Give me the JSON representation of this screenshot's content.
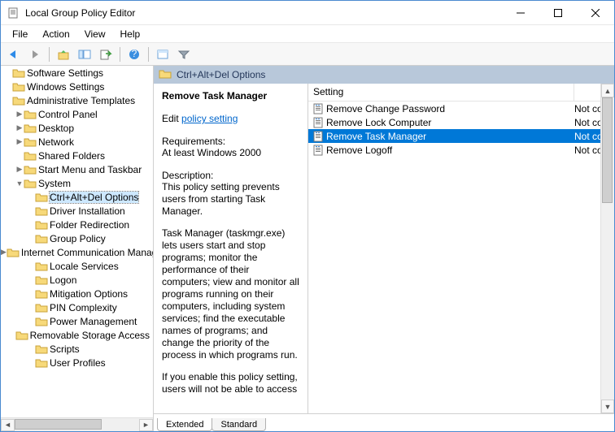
{
  "window": {
    "title": "Local Group Policy Editor"
  },
  "menu": {
    "file": "File",
    "action": "Action",
    "view": "View",
    "help": "Help"
  },
  "toolbar": {
    "back": "back",
    "forward": "forward",
    "up": "up",
    "show_hide_tree": "show-hide-tree",
    "export": "export",
    "refresh": "refresh",
    "help": "help",
    "properties": "properties",
    "filter": "filter"
  },
  "tree": {
    "roots": [
      {
        "label": "Software Settings",
        "depth": 0,
        "caret": ""
      },
      {
        "label": "Windows Settings",
        "depth": 0,
        "caret": ""
      },
      {
        "label": "Administrative Templates",
        "depth": 0,
        "caret": ""
      },
      {
        "label": "Control Panel",
        "depth": 1,
        "caret": ">"
      },
      {
        "label": "Desktop",
        "depth": 1,
        "caret": ">"
      },
      {
        "label": "Network",
        "depth": 1,
        "caret": ">"
      },
      {
        "label": "Shared Folders",
        "depth": 1,
        "caret": ""
      },
      {
        "label": "Start Menu and Taskbar",
        "depth": 1,
        "caret": ">"
      },
      {
        "label": "System",
        "depth": 1,
        "caret": "v"
      },
      {
        "label": "Ctrl+Alt+Del Options",
        "depth": 2,
        "caret": "",
        "selected": true
      },
      {
        "label": "Driver Installation",
        "depth": 2,
        "caret": ""
      },
      {
        "label": "Folder Redirection",
        "depth": 2,
        "caret": ""
      },
      {
        "label": "Group Policy",
        "depth": 2,
        "caret": ""
      },
      {
        "label": "Internet Communication Management",
        "depth": 2,
        "caret": ">"
      },
      {
        "label": "Locale Services",
        "depth": 2,
        "caret": ""
      },
      {
        "label": "Logon",
        "depth": 2,
        "caret": ""
      },
      {
        "label": "Mitigation Options",
        "depth": 2,
        "caret": ""
      },
      {
        "label": "PIN Complexity",
        "depth": 2,
        "caret": ""
      },
      {
        "label": "Power Management",
        "depth": 2,
        "caret": ""
      },
      {
        "label": "Removable Storage Access",
        "depth": 2,
        "caret": ""
      },
      {
        "label": "Scripts",
        "depth": 2,
        "caret": ""
      },
      {
        "label": "User Profiles",
        "depth": 2,
        "caret": ""
      }
    ]
  },
  "header": {
    "location": "Ctrl+Alt+Del Options"
  },
  "detail": {
    "heading": "Remove Task Manager",
    "edit_prefix": "Edit ",
    "edit_link": "policy setting",
    "req_label": "Requirements:",
    "req_value": "At least Windows 2000",
    "desc_label": "Description:",
    "desc_p1": "This policy setting prevents users from starting Task Manager.",
    "desc_p2": "Task Manager (taskmgr.exe) lets users start and stop programs; monitor the performance of their computers; view and monitor all programs running on their computers, including system services; find the executable names of programs; and change the priority of the process in which programs run.",
    "desc_p3": "If you enable this policy setting, users will not be able to access"
  },
  "list": {
    "col_setting": "Setting",
    "items": [
      {
        "name": "Remove Change Password",
        "state": "Not configured",
        "selected": false
      },
      {
        "name": "Remove Lock Computer",
        "state": "Not configured",
        "selected": false
      },
      {
        "name": "Remove Task Manager",
        "state": "Not configured",
        "selected": true
      },
      {
        "name": "Remove Logoff",
        "state": "Not configured",
        "selected": false
      }
    ]
  },
  "tabs": {
    "extended": "Extended",
    "standard": "Standard",
    "active": "extended"
  }
}
